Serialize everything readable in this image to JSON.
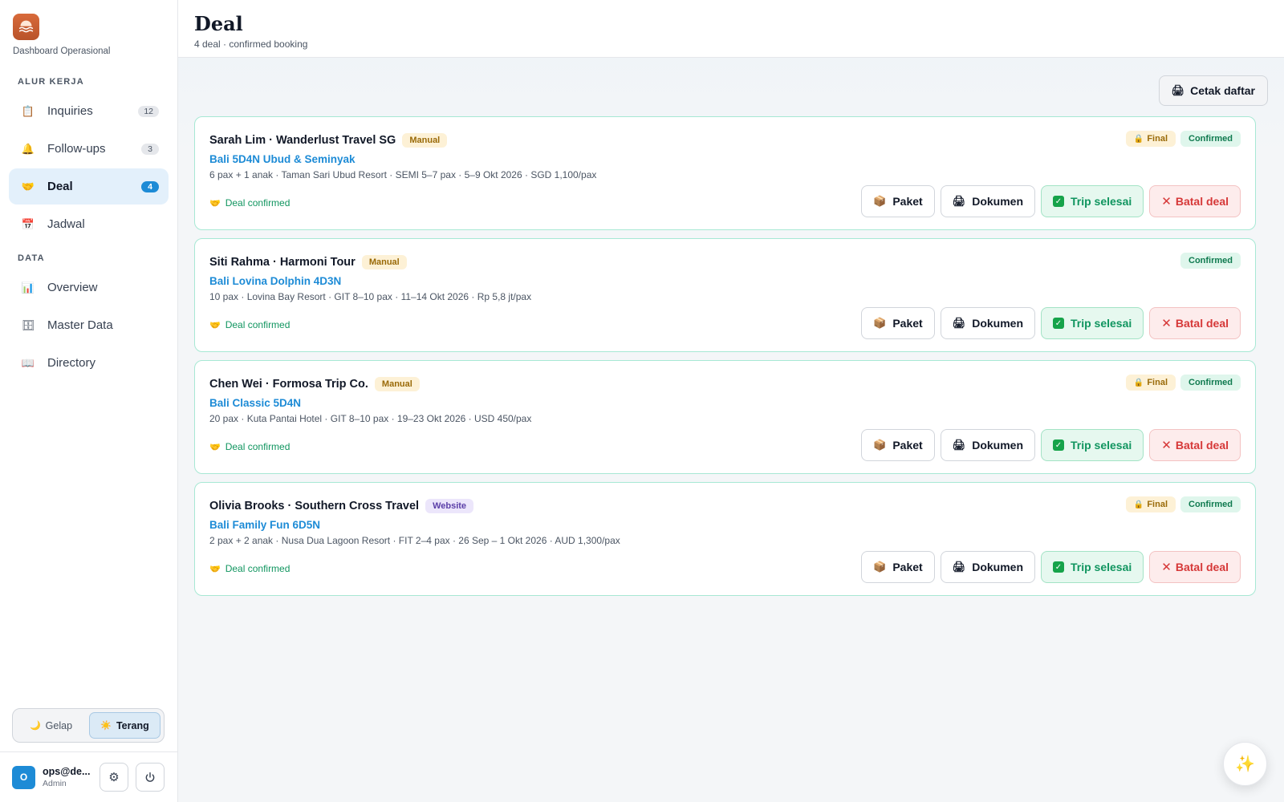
{
  "sidebar": {
    "brand_sub": "Dashboard Operasional",
    "sections": [
      {
        "label": "ALUR KERJA",
        "items": [
          {
            "label": "Inquiries",
            "icon": "clipboard-icon",
            "glyph": "📋",
            "count": "12",
            "active": false
          },
          {
            "label": "Follow-ups",
            "icon": "bell-icon",
            "glyph": "🔔",
            "count": "3",
            "active": false
          },
          {
            "label": "Deal",
            "icon": "handshake-icon",
            "glyph": "🤝",
            "count": "4",
            "active": true
          },
          {
            "label": "Jadwal",
            "icon": "calendar-icon",
            "glyph": "📅",
            "count": "",
            "active": false
          }
        ]
      },
      {
        "label": "DATA",
        "items": [
          {
            "label": "Overview",
            "icon": "bar-chart-icon",
            "glyph": "📊",
            "count": "",
            "active": false
          },
          {
            "label": "Master Data",
            "icon": "database-icon",
            "glyph": "🗄",
            "count": "",
            "active": false
          },
          {
            "label": "Directory",
            "icon": "book-icon",
            "glyph": "📖",
            "count": "",
            "active": false
          }
        ]
      }
    ],
    "theme": {
      "dark_label": "Gelap",
      "light_label": "Terang",
      "selected": "light"
    },
    "user": {
      "initial": "O",
      "email": "ops@de...",
      "role": "Admin"
    }
  },
  "header": {
    "title": "Deal",
    "subtitle": "4 deal · confirmed booking"
  },
  "toolbar": {
    "print_label": "Cetak daftar"
  },
  "deals": [
    {
      "title": "Sarah Lim · Wanderlust Travel SG",
      "source": "Manual",
      "source_type": "manual",
      "package": "Bali 5D4N Ubud & Seminyak",
      "meta": "6 pax + 1 anak · Taman Sari Ubud Resort · SEMI 5–7 pax · 5–9 Okt 2026 · SGD 1,100/pax",
      "status": "Deal confirmed",
      "final": true,
      "final_label": "Final",
      "confirmed_label": "Confirmed"
    },
    {
      "title": "Siti Rahma · Harmoni Tour",
      "source": "Manual",
      "source_type": "manual",
      "package": "Bali Lovina Dolphin 4D3N",
      "meta": "10 pax · Lovina Bay Resort · GIT 8–10 pax · 11–14 Okt 2026 · Rp 5,8 jt/pax",
      "status": "Deal confirmed",
      "final": false,
      "final_label": "",
      "confirmed_label": "Confirmed"
    },
    {
      "title": "Chen Wei · Formosa Trip Co.",
      "source": "Manual",
      "source_type": "manual",
      "package": "Bali Classic 5D4N",
      "meta": "20 pax · Kuta Pantai Hotel · GIT 8–10 pax · 19–23 Okt 2026 · USD 450/pax",
      "status": "Deal confirmed",
      "final": true,
      "final_label": "Final",
      "confirmed_label": "Confirmed"
    },
    {
      "title": "Olivia Brooks · Southern Cross Travel",
      "source": "Website",
      "source_type": "website",
      "package": "Bali Family Fun 6D5N",
      "meta": "2 pax + 2 anak · Nusa Dua Lagoon Resort · FIT 2–4 pax · 26 Sep – 1 Okt 2026 · AUD 1,300/pax",
      "status": "Deal confirmed",
      "final": true,
      "final_label": "Final",
      "confirmed_label": "Confirmed"
    }
  ],
  "actions": {
    "paket": "Paket",
    "dokumen": "Dokumen",
    "trip": "Trip selesai",
    "batal": "Batal deal"
  },
  "colors": {
    "accent": "#1d8bd6",
    "success": "#10955f",
    "danger": "#d63838",
    "brand": "#c85d31"
  }
}
